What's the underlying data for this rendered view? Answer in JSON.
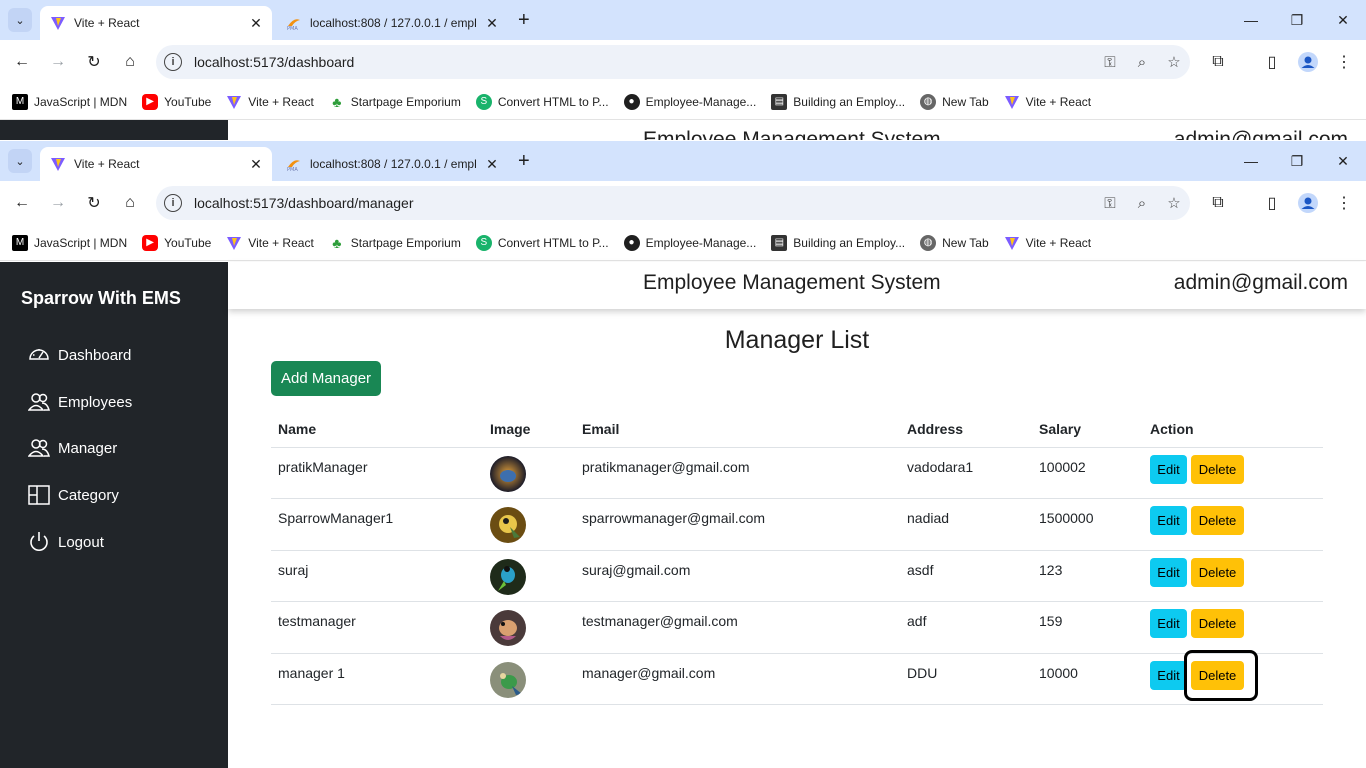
{
  "browser_back": {
    "tabs": [
      {
        "title": "Vite + React",
        "active": true
      },
      {
        "title": "localhost:808 / 127.0.0.1 / empl",
        "active": false
      }
    ],
    "url": "localhost:5173/dashboard"
  },
  "browser": {
    "tabs": [
      {
        "title": "Vite + React",
        "active": true
      },
      {
        "title": "localhost:808 / 127.0.0.1 / empl",
        "active": false
      }
    ],
    "url": "localhost:5173/dashboard/manager",
    "bookmarks": [
      {
        "label": "JavaScript | MDN",
        "icon": "mdn-icon"
      },
      {
        "label": "YouTube",
        "icon": "youtube-icon"
      },
      {
        "label": "Vite + React",
        "icon": "vite-icon"
      },
      {
        "label": "Startpage Emporium",
        "icon": "clover-icon"
      },
      {
        "label": "Convert HTML to P...",
        "icon": "convert-icon"
      },
      {
        "label": "Employee-Manage...",
        "icon": "github-icon"
      },
      {
        "label": "Building an Employ...",
        "icon": "article-icon"
      },
      {
        "label": "New Tab",
        "icon": "globe-icon"
      },
      {
        "label": "Vite + React",
        "icon": "vite-icon"
      }
    ]
  },
  "back_page": {
    "title": "Employee Management System",
    "admin": "admin@gmail.com"
  },
  "sidebar": {
    "brand": "Sparrow With EMS",
    "items": [
      {
        "label": "Dashboard",
        "icon": "speedometer-icon"
      },
      {
        "label": "Employees",
        "icon": "people-icon"
      },
      {
        "label": "Manager",
        "icon": "people-icon"
      },
      {
        "label": "Category",
        "icon": "columns-icon"
      },
      {
        "label": "Logout",
        "icon": "power-icon"
      }
    ]
  },
  "header": {
    "title": "Employee Management System",
    "admin": "admin@gmail.com"
  },
  "main": {
    "title": "Manager List",
    "add_button": "Add Manager",
    "columns": [
      "Name",
      "Image",
      "Email",
      "Address",
      "Salary",
      "Action"
    ],
    "edit_label": "Edit",
    "delete_label": "Delete",
    "rows": [
      {
        "name": "pratikManager",
        "email": "pratikmanager@gmail.com",
        "address": "vadodara1",
        "salary": "100002"
      },
      {
        "name": "SparrowManager1",
        "email": "sparrowmanager@gmail.com",
        "address": "nadiad",
        "salary": "1500000"
      },
      {
        "name": "suraj",
        "email": "suraj@gmail.com",
        "address": "asdf",
        "salary": "123"
      },
      {
        "name": "testmanager",
        "email": "testmanager@gmail.com",
        "address": "adf",
        "salary": "159"
      },
      {
        "name": "manager 1",
        "email": "manager@gmail.com",
        "address": "DDU",
        "salary": "10000"
      }
    ]
  },
  "colors": {
    "tabstrip": "#d3e3fd",
    "sidebar": "#212529",
    "add_button": "#198754",
    "edit_button": "#0dcaf0",
    "delete_button": "#ffc107"
  }
}
